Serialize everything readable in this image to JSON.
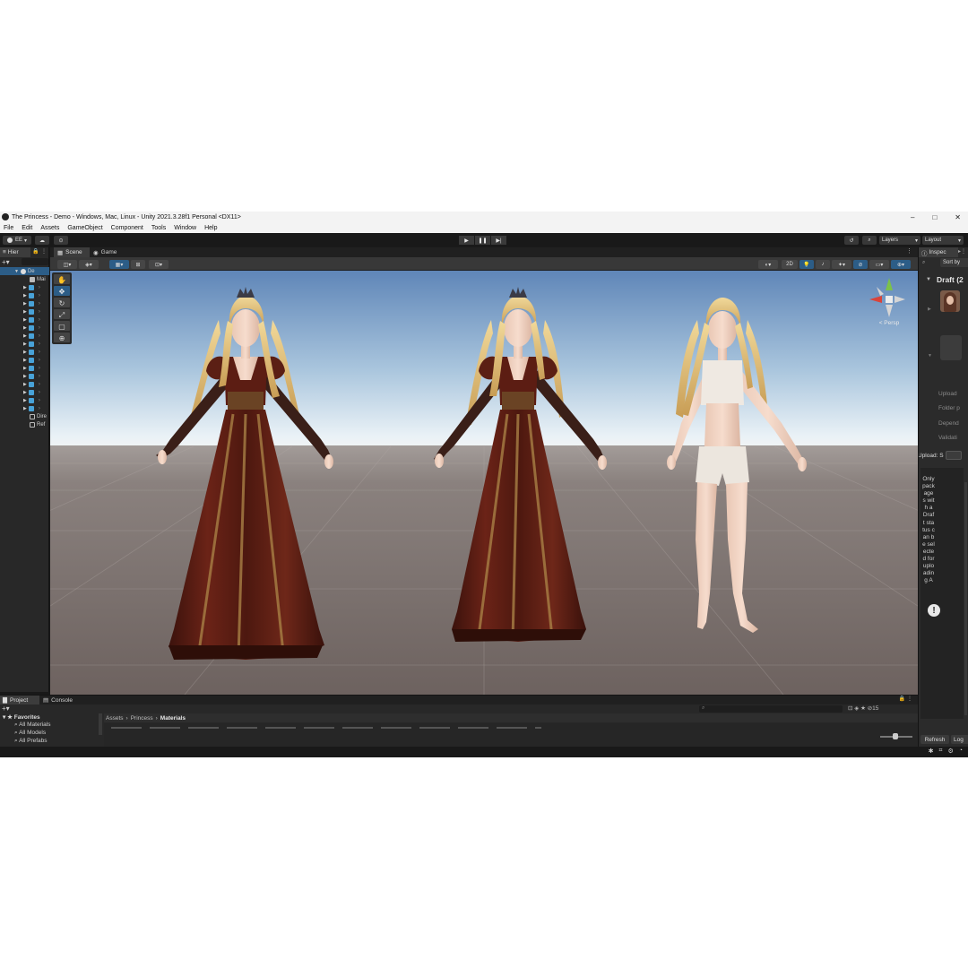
{
  "window": {
    "title": "The Princess - Demo - Windows, Mac, Linux - Unity 2021.3.28f1 Personal <DX11>",
    "controls": [
      "–",
      "□",
      "✕"
    ]
  },
  "menu": [
    "File",
    "Edit",
    "Assets",
    "GameObject",
    "Component",
    "Tools",
    "Window",
    "Help"
  ],
  "toolbar": {
    "account": "EE",
    "layers": "Layers",
    "layout": "Layout"
  },
  "hierarchy": {
    "tab": "Hier",
    "scene_root": "De",
    "rows": [
      "Mai",
      "",
      "",
      "",
      "",
      "",
      "",
      "",
      "",
      "",
      "",
      "",
      "",
      "",
      "",
      "",
      "",
      "Dire",
      "Ref"
    ]
  },
  "scene": {
    "tabs": [
      "Scene",
      "Game"
    ],
    "toggle_2d": "2D",
    "persp": "< Persp",
    "models": [
      {
        "outfit": "gown"
      },
      {
        "outfit": "gown"
      },
      {
        "outfit": "underwear"
      }
    ]
  },
  "inspector": {
    "tab": "Inspec",
    "sort": "Sort by",
    "draft": "Draft (2",
    "labels": [
      "Upload",
      "Folder p",
      "Depend",
      "Validati"
    ],
    "upload_field": "Upload: S",
    "vertical_message": "Only packages with a Draft status can be selected for uploading A",
    "refresh": "Refresh",
    "log": "Log"
  },
  "project": {
    "tabs": [
      "Project",
      "Console"
    ],
    "favorites": "Favorites",
    "favorites_items": [
      "All Materials",
      "All Models",
      "All Prefabs"
    ],
    "breadcrumb": [
      "Assets",
      "Princess",
      "Materials"
    ],
    "hidden_count": "15"
  },
  "colors": {
    "editor_bg": "#191919",
    "panel_bg": "#282828",
    "accent_blue": "#2c5d87",
    "gown_red": "#5a1e14",
    "hair_blonde": "#e3c27a"
  }
}
